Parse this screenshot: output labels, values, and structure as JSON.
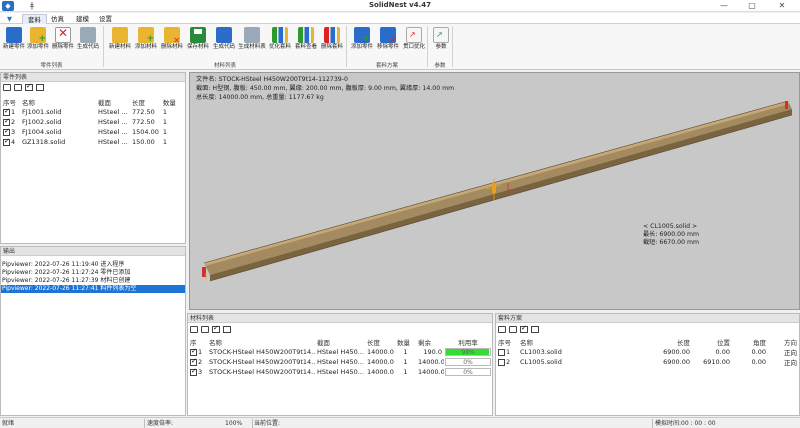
{
  "window": {
    "title": "SolidNest v4.47",
    "min": "—",
    "max": "▢",
    "close": "✕"
  },
  "menus": [
    "",
    "套料",
    "仿真",
    "建模",
    "设置"
  ],
  "ribbon": {
    "groups": [
      {
        "label": "零件列表",
        "buttons": [
          "新建零件",
          "添加零件",
          "删除零件",
          "生成代码"
        ]
      },
      {
        "label": "材料列表",
        "buttons": [
          "新建材料",
          "添加材料",
          "删除材料",
          "保存材料",
          "生成代码",
          "生成材料表",
          "优化套料",
          "套料查看",
          "删除套料"
        ]
      },
      {
        "label": "套料方案",
        "buttons": [
          "添加零件",
          "移除零件",
          "贯口优化"
        ]
      },
      {
        "label": "参数",
        "buttons": [
          "参数"
        ]
      }
    ]
  },
  "parts_panel": {
    "title": "零件列表",
    "columns": [
      "序号",
      "名称",
      "截面",
      "长度",
      "数量"
    ],
    "rows": [
      {
        "no": "1",
        "name": "FJ1001.solid",
        "section": "HSteel ...",
        "length": "772.50",
        "qty": "1"
      },
      {
        "no": "2",
        "name": "FJ1002.solid",
        "section": "HSteel ...",
        "length": "772.50",
        "qty": "1"
      },
      {
        "no": "3",
        "name": "FJ1004.solid",
        "section": "HSteel ...",
        "length": "1504.00",
        "qty": "1"
      },
      {
        "no": "4",
        "name": "GZ1318.solid",
        "section": "HSteel ...",
        "length": "150.00",
        "qty": "1"
      }
    ]
  },
  "output_panel": {
    "title": "输出",
    "lines": [
      "Pipviewer: 2022-07-26 11:19:40 进入程序",
      "Pipviewer: 2022-07-26 11:27:24 零件已添加",
      "Pipviewer: 2022-07-26 11:27:39 材料已创建",
      "Pipviewer: 2022-07-26 11:27:41 料件列表为空"
    ]
  },
  "view": {
    "info": [
      "文件名: STOCK-HSteel H450W200T9t14-112739-0",
      "截面: H型钢, 腹板: 450.00 mm, 翼缘: 200.00 mm, 腹板厚: 9.00 mm, 翼缘厚: 14.00 mm",
      "总长度: 14000.00 mm, 总重量: 1177.67 kg"
    ],
    "callout": [
      "< CL1005.solid >",
      "最长: 6900.00 mm",
      "截短: 6670.00 mm"
    ]
  },
  "material_panel": {
    "title": "材料列表",
    "columns": [
      "序",
      "名称",
      "截面",
      "长度",
      "数量",
      "剩余",
      "利用率"
    ],
    "rows": [
      {
        "no": "1",
        "name": "STOCK-HSteel H450W200T9t14...",
        "section": "HSteel H450...",
        "length": "14000.0",
        "qty": "1",
        "remain": "190.0",
        "util": "98%",
        "util_fill": 0.98
      },
      {
        "no": "2",
        "name": "STOCK-HSteel H450W200T9t14...",
        "section": "HSteel H450...",
        "length": "14000.0",
        "qty": "1",
        "remain": "14000.0",
        "util": "0%",
        "util_fill": 0
      },
      {
        "no": "3",
        "name": "STOCK-HSteel H450W200T9t14...",
        "section": "HSteel H450...",
        "length": "14000.0",
        "qty": "1",
        "remain": "14000.0",
        "util": "0%",
        "util_fill": 0
      }
    ]
  },
  "nest_panel": {
    "title": "套料方案",
    "columns": [
      "序号",
      "名称",
      "长度",
      "位置",
      "角度",
      "方向"
    ],
    "rows": [
      {
        "no": "1",
        "name": "CL1003.solid",
        "length": "6900.00",
        "pos": "0.00",
        "angle": "0.00",
        "dir": "正向"
      },
      {
        "no": "2",
        "name": "CL1005.solid",
        "length": "6900.00",
        "pos": "6910.00",
        "angle": "0.00",
        "dir": "正向"
      }
    ]
  },
  "status": {
    "ready": "就绪",
    "speed": "速度倍率:",
    "speed_value": "100%",
    "current": "当前位置:",
    "sim_time": "模拟时间:00 : 00 : 00"
  },
  "colors": {
    "selected": "#1e74d6",
    "util_full": "#33dd33",
    "beam": "#a0855a"
  }
}
